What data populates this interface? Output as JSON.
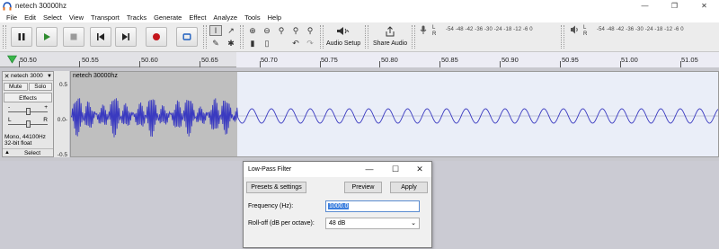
{
  "window": {
    "title": "netech 30000hz"
  },
  "menu": [
    "File",
    "Edit",
    "Select",
    "View",
    "Transport",
    "Tracks",
    "Generate",
    "Effect",
    "Analyze",
    "Tools",
    "Help"
  ],
  "toolbar": {
    "audio_setup_label": "Audio Setup",
    "share_audio_label": "Share Audio",
    "record_meter_scale": "-54  -48  -42  -36  -30  -24  -18  -12  -6   0",
    "play_meter_scale": "-54  -48  -42  -36  -30  -24  -18  -12  -6   0",
    "meter_l": "L",
    "meter_r": "R",
    "colors": {
      "record": "#c4161c",
      "play": "#2e8b2e",
      "accent": "#3b7ede"
    }
  },
  "ruler": {
    "start": "50.50",
    "ticks": [
      "50.55",
      "50.60",
      "50.65",
      "50.70",
      "50.75",
      "50.80",
      "50.85",
      "50.90",
      "50.95",
      "51.00",
      "51.05"
    ]
  },
  "track": {
    "name": "netech 3000",
    "clip_name": "netech 30000hz",
    "mute": "Mute",
    "solo": "Solo",
    "effects": "Effects",
    "gain_minus": "-",
    "gain_plus": "+",
    "pan_l": "L",
    "pan_r": "R",
    "info_line1": "Mono, 44100Hz",
    "info_line2": "32-bit float",
    "select": "Select",
    "scale_top": "0.5",
    "scale_mid": "0.0-",
    "scale_bottom": "-0.5"
  },
  "dialog": {
    "title": "Low-Pass Filter",
    "presets_button": "Presets & settings",
    "preview_button": "Preview",
    "apply_button": "Apply",
    "frequency_label": "Frequency (Hz):",
    "frequency_value": "1000.0",
    "rolloff_label": "Roll-off (dB per octave):",
    "rolloff_value": "48 dB"
  }
}
